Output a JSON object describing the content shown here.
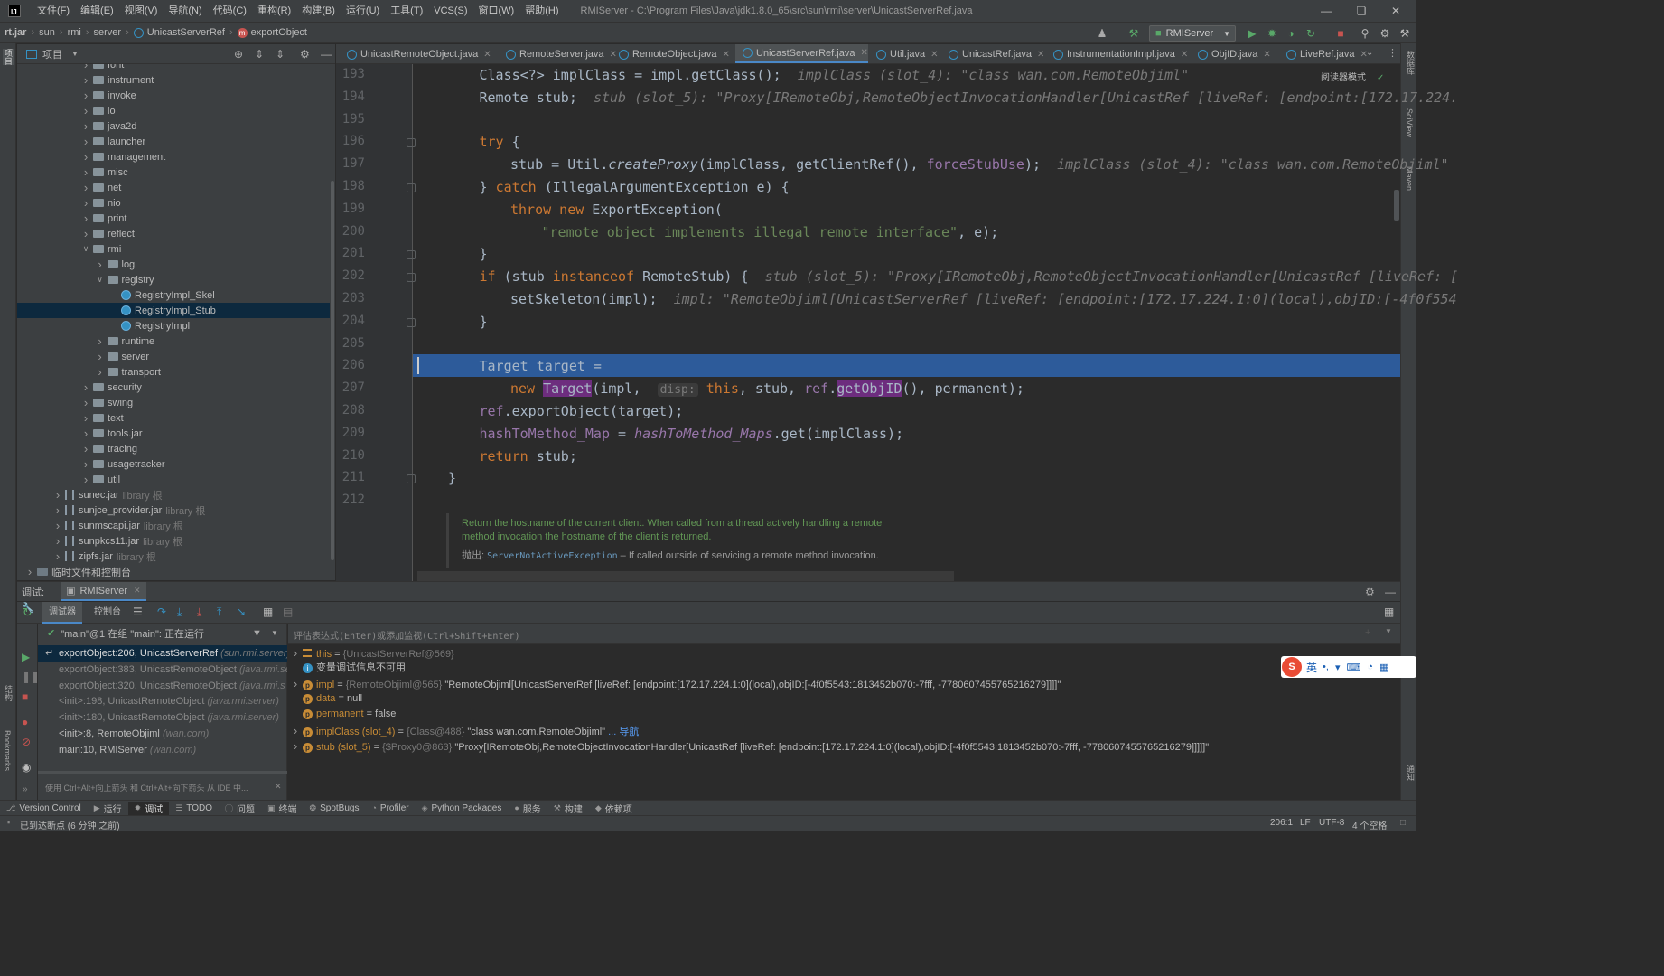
{
  "window": {
    "title": "RMIServer - C:\\Program Files\\Java\\jdk1.8.0_65\\src\\sun\\rmi\\server\\UnicastServerRef.java",
    "menu": [
      "文件(F)",
      "编辑(E)",
      "视图(V)",
      "导航(N)",
      "代码(C)",
      "重构(R)",
      "构建(B)",
      "运行(U)",
      "工具(T)",
      "VCS(S)",
      "窗口(W)",
      "帮助(H)"
    ]
  },
  "breadcrumb": [
    "rt.jar",
    "sun",
    "rmi",
    "server",
    "UnicastServerRef",
    "exportObject"
  ],
  "toolbar": {
    "run_config": "RMIServer"
  },
  "project": {
    "header": "项目",
    "tree": [
      {
        "label": "font",
        "depth": 4,
        "kind": "folder",
        "exp": "closed"
      },
      {
        "label": "instrument",
        "depth": 4,
        "kind": "folder",
        "exp": "closed"
      },
      {
        "label": "invoke",
        "depth": 4,
        "kind": "folder",
        "exp": "closed"
      },
      {
        "label": "io",
        "depth": 4,
        "kind": "folder",
        "exp": "closed"
      },
      {
        "label": "java2d",
        "depth": 4,
        "kind": "folder",
        "exp": "closed"
      },
      {
        "label": "launcher",
        "depth": 4,
        "kind": "folder",
        "exp": "closed"
      },
      {
        "label": "management",
        "depth": 4,
        "kind": "folder",
        "exp": "closed"
      },
      {
        "label": "misc",
        "depth": 4,
        "kind": "folder",
        "exp": "closed"
      },
      {
        "label": "net",
        "depth": 4,
        "kind": "folder",
        "exp": "closed"
      },
      {
        "label": "nio",
        "depth": 4,
        "kind": "folder",
        "exp": "closed"
      },
      {
        "label": "print",
        "depth": 4,
        "kind": "folder",
        "exp": "closed"
      },
      {
        "label": "reflect",
        "depth": 4,
        "kind": "folder",
        "exp": "closed"
      },
      {
        "label": "rmi",
        "depth": 4,
        "kind": "folder",
        "exp": "open"
      },
      {
        "label": "log",
        "depth": 5,
        "kind": "folder",
        "exp": "closed"
      },
      {
        "label": "registry",
        "depth": 5,
        "kind": "folder",
        "exp": "open"
      },
      {
        "label": "RegistryImpl_Skel",
        "depth": 6,
        "kind": "class",
        "exp": ""
      },
      {
        "label": "RegistryImpl_Stub",
        "depth": 6,
        "kind": "class",
        "exp": "",
        "selected": true
      },
      {
        "label": "RegistryImpl",
        "depth": 6,
        "kind": "class",
        "exp": ""
      },
      {
        "label": "runtime",
        "depth": 5,
        "kind": "folder",
        "exp": "closed"
      },
      {
        "label": "server",
        "depth": 5,
        "kind": "folder",
        "exp": "closed"
      },
      {
        "label": "transport",
        "depth": 5,
        "kind": "folder",
        "exp": "closed"
      },
      {
        "label": "security",
        "depth": 4,
        "kind": "folder",
        "exp": "closed"
      },
      {
        "label": "swing",
        "depth": 4,
        "kind": "folder",
        "exp": "closed"
      },
      {
        "label": "text",
        "depth": 4,
        "kind": "folder",
        "exp": "closed"
      },
      {
        "label": "tools.jar",
        "depth": 4,
        "kind": "folder",
        "exp": "closed"
      },
      {
        "label": "tracing",
        "depth": 4,
        "kind": "folder",
        "exp": "closed"
      },
      {
        "label": "usagetracker",
        "depth": 4,
        "kind": "folder",
        "exp": "closed"
      },
      {
        "label": "util",
        "depth": 4,
        "kind": "folder",
        "exp": "closed"
      },
      {
        "label": "sunec.jar",
        "depth": 2,
        "kind": "jar",
        "exp": "closed",
        "suffix": "library 根"
      },
      {
        "label": "sunjce_provider.jar",
        "depth": 2,
        "kind": "jar",
        "exp": "closed",
        "suffix": "library 根"
      },
      {
        "label": "sunmscapi.jar",
        "depth": 2,
        "kind": "jar",
        "exp": "closed",
        "suffix": "library 根"
      },
      {
        "label": "sunpkcs11.jar",
        "depth": 2,
        "kind": "jar",
        "exp": "closed",
        "suffix": "library 根"
      },
      {
        "label": "zipfs.jar",
        "depth": 2,
        "kind": "jar",
        "exp": "closed",
        "suffix": "library 根"
      },
      {
        "label": "临时文件和控制台",
        "depth": 0,
        "kind": "scratch",
        "exp": "closed"
      }
    ]
  },
  "tabs": [
    {
      "label": "UnicastRemoteObject.java",
      "active": false
    },
    {
      "label": "RemoteServer.java",
      "active": false
    },
    {
      "label": "RemoteObject.java",
      "active": false
    },
    {
      "label": "UnicastServerRef.java",
      "active": true
    },
    {
      "label": "Util.java",
      "active": false
    },
    {
      "label": "UnicastRef.java",
      "active": false
    },
    {
      "label": "InstrumentationImpl.java",
      "active": false
    },
    {
      "label": "ObjID.java",
      "active": false
    },
    {
      "label": "LiveRef.java",
      "active": false
    }
  ],
  "editor": {
    "reader_mode": "阅读器模式",
    "current_line": 206,
    "lines": [
      {
        "n": "193",
        "indent": 1,
        "html": "Class&lt;?&gt; implClass = impl.getClass();  <span class=\"inl\">implClass (slot_4): \"class wan.com.RemoteObjiml\"</span>"
      },
      {
        "n": "194",
        "indent": 1,
        "html": "Remote stub;  <span class=\"inl\">stub (slot_5): \"Proxy[IRemoteObj,RemoteObjectInvocationHandler[UnicastRef [liveRef: [endpoint:[172.17.224.</span>"
      },
      {
        "n": "195",
        "indent": 0,
        "html": ""
      },
      {
        "n": "196",
        "indent": 1,
        "html": "<span class=\"kw\">try</span> {"
      },
      {
        "n": "197",
        "indent": 2,
        "html": "stub = Util.<span class=\"it\">createProxy</span>(implClass, getClientRef(), <span class=\"field\">forceStubUse</span>);  <span class=\"inl\">implClass (slot_4): \"class wan.com.RemoteObjiml\"</span>"
      },
      {
        "n": "198",
        "indent": 1,
        "html": "} <span class=\"kw\">catch</span> (IllegalArgumentException e) {"
      },
      {
        "n": "199",
        "indent": 2,
        "html": "<span class=\"kw\">throw new</span> ExportException("
      },
      {
        "n": "200",
        "indent": 3,
        "html": "<span class=\"str\">\"remote object implements illegal remote interface\"</span>, e);"
      },
      {
        "n": "201",
        "indent": 1,
        "html": "}"
      },
      {
        "n": "202",
        "indent": 1,
        "html": "<span class=\"kw\">if</span> (stub <span class=\"kw\">instanceof</span> RemoteStub) {  <span class=\"inl\">stub (slot_5): \"Proxy[IRemoteObj,RemoteObjectInvocationHandler[UnicastRef [liveRef: [</span>"
      },
      {
        "n": "203",
        "indent": 2,
        "html": "setSkeleton(impl);  <span class=\"inl\">impl: \"RemoteObjiml[UnicastServerRef [liveRef: [endpoint:[172.17.224.1:0](local),objID:[-4f0f554</span>"
      },
      {
        "n": "204",
        "indent": 1,
        "html": "}"
      },
      {
        "n": "205",
        "indent": 0,
        "html": ""
      },
      {
        "n": "206",
        "indent": 1,
        "html": "Target target ="
      },
      {
        "n": "207",
        "indent": 2,
        "html": "<span class=\"kw\">new</span> <span class=\"hlbox\">Target</span>(impl,  <span class=\"hint\">disp:</span> <span class=\"kw\">this</span>, stub, <span class=\"field\">ref</span>.<span class=\"hlbox\">getObjID</span>(), permanent);"
      },
      {
        "n": "208",
        "indent": 1,
        "html": "<span class=\"field\">ref</span>.exportObject(target);"
      },
      {
        "n": "209",
        "indent": 1,
        "html": "<span class=\"field\">hashToMethod_Map</span> = <span class=\"field it\">hashToMethod_Maps</span>.get(implClass);"
      },
      {
        "n": "210",
        "indent": 1,
        "html": "<span class=\"kw\">return</span> stub;"
      },
      {
        "n": "211",
        "indent": 0,
        "html": "}"
      },
      {
        "n": "212",
        "indent": 0,
        "html": ""
      }
    ],
    "doc": {
      "line1": "Return the hostname of the current client. When called from a thread actively handling a remote",
      "line2": "method invocation the hostname of the client is returned.",
      "throws_label": "抛出:",
      "throws_class": "ServerNotActiveException",
      "throws_text": " – If called outside of servicing a remote method invocation."
    }
  },
  "debug": {
    "label": "调试:",
    "session": "RMIServer",
    "tabs": [
      "调试器",
      "控制台"
    ],
    "thread": "\"main\"@1 在组 \"main\": 正在运行",
    "eval_placeholder": "评估表达式(Enter)或添加监视(Ctrl+Shift+Enter)",
    "hint": "使用 Ctrl+Alt+向上箭头 和 Ctrl+Alt+向下箭头 从 IDE 中...",
    "frames": [
      {
        "method": "exportObject:206, UnicastServerRef",
        "pkg": "(sun.rmi.server)",
        "selected": true
      },
      {
        "method": "exportObject:383, UnicastRemoteObject",
        "pkg": "(java.rmi.se"
      },
      {
        "method": "exportObject:320, UnicastRemoteObject",
        "pkg": "(java.rmi.s"
      },
      {
        "method": "<init>:198, UnicastRemoteObject",
        "pkg": "(java.rmi.server)"
      },
      {
        "method": "<init>:180, UnicastRemoteObject",
        "pkg": "(java.rmi.server)"
      },
      {
        "method": "<init>:8, RemoteObjiml",
        "pkg": "(wan.com)"
      },
      {
        "method": "main:10, RMIServer",
        "pkg": "(wan.com)"
      }
    ],
    "vars": [
      {
        "icon": "field",
        "exp": true,
        "name": "this",
        "eq": " = ",
        "gray": "{UnicastServerRef@569}",
        "val": ""
      },
      {
        "icon": "info",
        "exp": false,
        "name": "",
        "eq": "",
        "gray": "",
        "val": "变量调试信息不可用"
      },
      {
        "icon": "param",
        "exp": true,
        "name": "impl",
        "eq": " = ",
        "gray": "{RemoteObjiml@565}",
        "val": " \"RemoteObjiml[UnicastServerRef [liveRef: [endpoint:[172.17.224.1:0](local),objID:[-4f0f5543:1813452b070:-7fff, -7780607455765216279]]]]\""
      },
      {
        "icon": "param",
        "exp": false,
        "name": "data",
        "eq": " = ",
        "gray": "",
        "val": "null"
      },
      {
        "icon": "param",
        "exp": false,
        "name": "permanent",
        "eq": " = ",
        "gray": "",
        "val": "false"
      },
      {
        "icon": "param",
        "exp": true,
        "name": "implClass (slot_4)",
        "eq": " = ",
        "gray": "{Class@488}",
        "val": " \"class wan.com.RemoteObjiml\"",
        "link": "... 导航"
      },
      {
        "icon": "param",
        "exp": true,
        "name": "stub (slot_5)",
        "eq": " = ",
        "gray": "{$Proxy0@863}",
        "val": " \"Proxy[IRemoteObj,RemoteObjectInvocationHandler[UnicastRef [liveRef: [endpoint:[172.17.224.1:0](local),objID:[-4f0f5543:1813452b070:-7fff, -7780607455765216279]]]]]\""
      }
    ]
  },
  "bottom_tools": [
    "Version Control",
    "运行",
    "调试",
    "TODO",
    "问题",
    "终端",
    "SpotBugs",
    "Profiler",
    "Python Packages",
    "服务",
    "构建",
    "依赖项"
  ],
  "status": {
    "left": "已到达断点 (6 分钟 之前)",
    "position": "206:1",
    "line_sep": "LF",
    "encoding": "UTF-8",
    "indent": "4 个空格"
  },
  "left_strip": [
    "项目",
    "结构",
    "Bookmarks"
  ],
  "right_strip": [
    "数据库",
    "SciView",
    "Maven",
    "通知"
  ],
  "ime": {
    "lang": "英"
  }
}
